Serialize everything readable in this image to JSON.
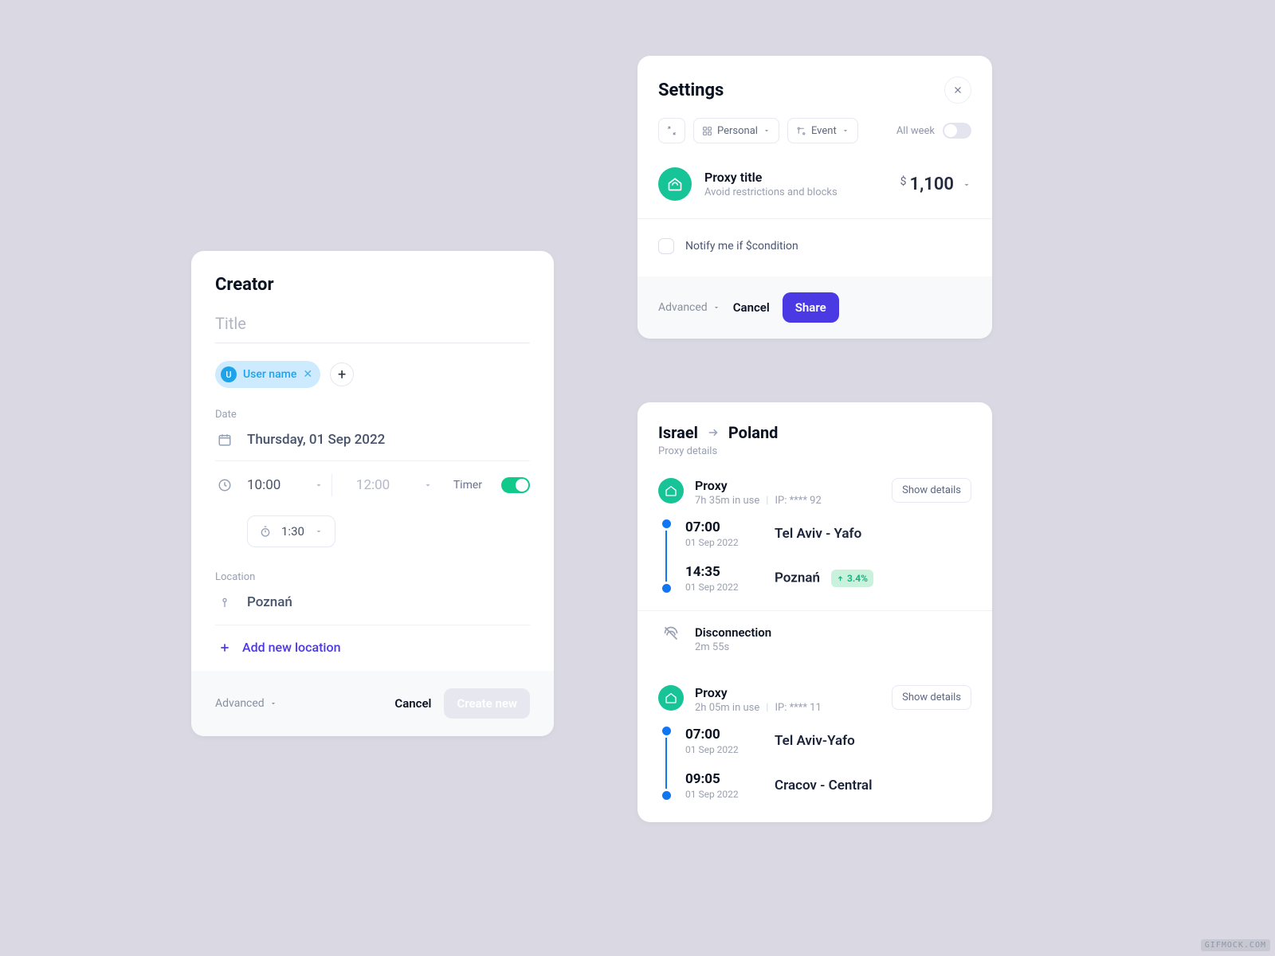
{
  "creator": {
    "heading": "Creator",
    "title_placeholder": "Title",
    "user_chip": {
      "initial": "U",
      "name": "User name"
    },
    "date": {
      "label": "Date",
      "value": "Thursday, 01 Sep 2022"
    },
    "time_from": "10:00",
    "time_to": "12:00",
    "timer_label": "Timer",
    "duration": "1:30",
    "location_label": "Location",
    "location_value": "Poznań",
    "add_location": "Add new location",
    "advanced": "Advanced",
    "cancel": "Cancel",
    "create": "Create new"
  },
  "settings": {
    "heading": "Settings",
    "filter_personal": "Personal",
    "filter_event": "Event",
    "all_week": "All week",
    "proxy_title": "Proxy title",
    "proxy_subtitle": "Avoid restrictions and blocks",
    "price_currency": "$",
    "price_amount": "1,100",
    "notify_label": "Notify me if $condition",
    "advanced": "Advanced",
    "cancel": "Cancel",
    "share": "Share"
  },
  "details": {
    "route_from": "Israel",
    "route_to": "Poland",
    "subtitle": "Proxy details",
    "show_details": "Show details",
    "segments": [
      {
        "title": "Proxy",
        "duration": "7h 35m in use",
        "ip": "IP: **** 92",
        "a_time": "07:00",
        "a_date": "01 Sep 2022",
        "a_place": "Tel Aviv - Yafo",
        "b_time": "14:35",
        "b_date": "01 Sep 2022",
        "b_place": "Poznań",
        "pct": "3.4%"
      },
      {
        "title": "Proxy",
        "duration": "2h 05m in use",
        "ip": "IP: **** 11",
        "a_time": "07:00",
        "a_date": "01 Sep 2022",
        "a_place": "Tel Aviv-Yafo",
        "b_time": "09:05",
        "b_date": "01 Sep 2022",
        "b_place": "Cracov - Central"
      }
    ],
    "disconnection_title": "Disconnection",
    "disconnection_time": "2m 55s"
  },
  "watermark": "GIFMOCK.COM"
}
